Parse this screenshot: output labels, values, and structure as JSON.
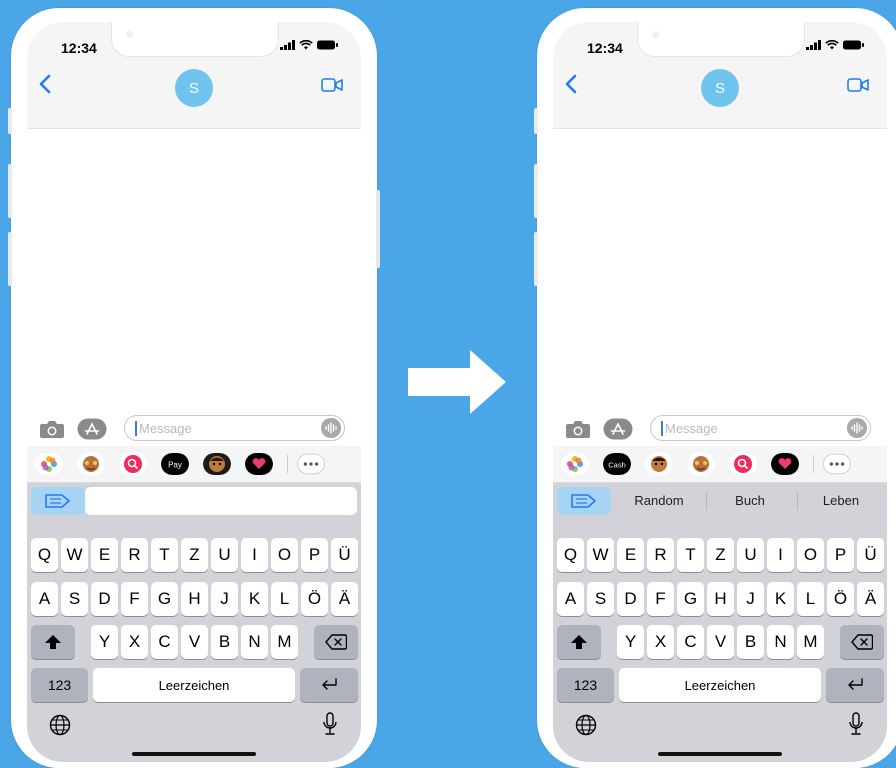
{
  "colors": {
    "background": "#4aa6e6",
    "avatar": "#6ec4ef",
    "accent": "#1f7cf1",
    "keyboard": "#d2d3d8"
  },
  "left_phone": {
    "status_time": "12:34",
    "avatar_initial": "S",
    "message_placeholder": "Message",
    "app_icons": [
      "photos-icon",
      "memoji-icon",
      "search-images-icon",
      "apple-pay-icon",
      "memoji-icon-2",
      "digital-touch-icon",
      "more-icon"
    ],
    "apple_pay_label": "Pay",
    "suggestions": [],
    "keyboard": {
      "row1": [
        "Q",
        "W",
        "E",
        "R",
        "T",
        "Z",
        "U",
        "I",
        "O",
        "P",
        "Ü"
      ],
      "row2": [
        "A",
        "S",
        "D",
        "F",
        "G",
        "H",
        "J",
        "K",
        "L",
        "Ö",
        "Ä"
      ],
      "row3": [
        "Y",
        "X",
        "C",
        "V",
        "B",
        "N",
        "M"
      ],
      "numbers_label": "123",
      "space_label": "Leerzeichen"
    }
  },
  "right_phone": {
    "status_time": "12:34",
    "avatar_initial": "S",
    "message_placeholder": "Message",
    "app_icons": [
      "photos-icon",
      "apple-cash-icon",
      "memoji-icon",
      "memoji-icon-2",
      "search-images-icon",
      "digital-touch-icon",
      "more-icon"
    ],
    "cash_label": "Cash",
    "suggestions": [
      "Random",
      "Buch",
      "Leben"
    ],
    "keyboard": {
      "row1": [
        "Q",
        "W",
        "E",
        "R",
        "T",
        "Z",
        "U",
        "I",
        "O",
        "P",
        "Ü"
      ],
      "row2": [
        "A",
        "S",
        "D",
        "F",
        "G",
        "H",
        "J",
        "K",
        "L",
        "Ö",
        "Ä"
      ],
      "row3": [
        "Y",
        "X",
        "C",
        "V",
        "B",
        "N",
        "M"
      ],
      "numbers_label": "123",
      "space_label": "Leerzeichen"
    }
  }
}
